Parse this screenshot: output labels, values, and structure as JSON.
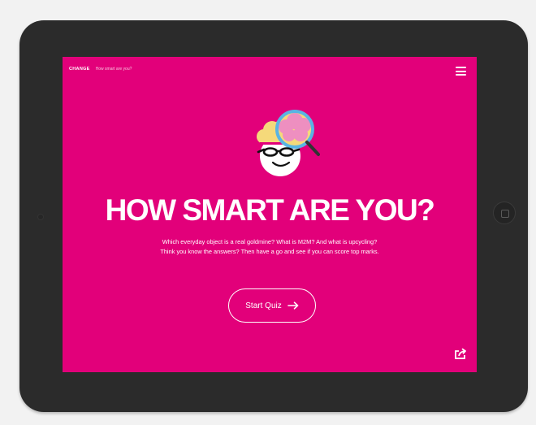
{
  "header": {
    "brand": "CHANGE",
    "breadcrumb": "How smart are you?"
  },
  "hero": {
    "headline": "HOW SMART ARE YOU?",
    "description_lines": [
      "Which everyday object is a real goldmine? What is M2M? And what is upcycling?",
      "Think you know the answers? Then have a go and see if you can score top marks."
    ]
  },
  "cta": {
    "label": "Start Quiz"
  },
  "colors": {
    "background": "#e2007a",
    "bezel": "#2b2b2b",
    "brain": "#f5d97a",
    "brain_magnified": "#ee8fc0",
    "lens_ring": "#5ab4e3"
  },
  "icons": {
    "menu": "hamburger-menu-icon",
    "arrow": "arrow-right-icon",
    "share": "share-icon",
    "illustration": "brain-magnifier-illustration"
  }
}
